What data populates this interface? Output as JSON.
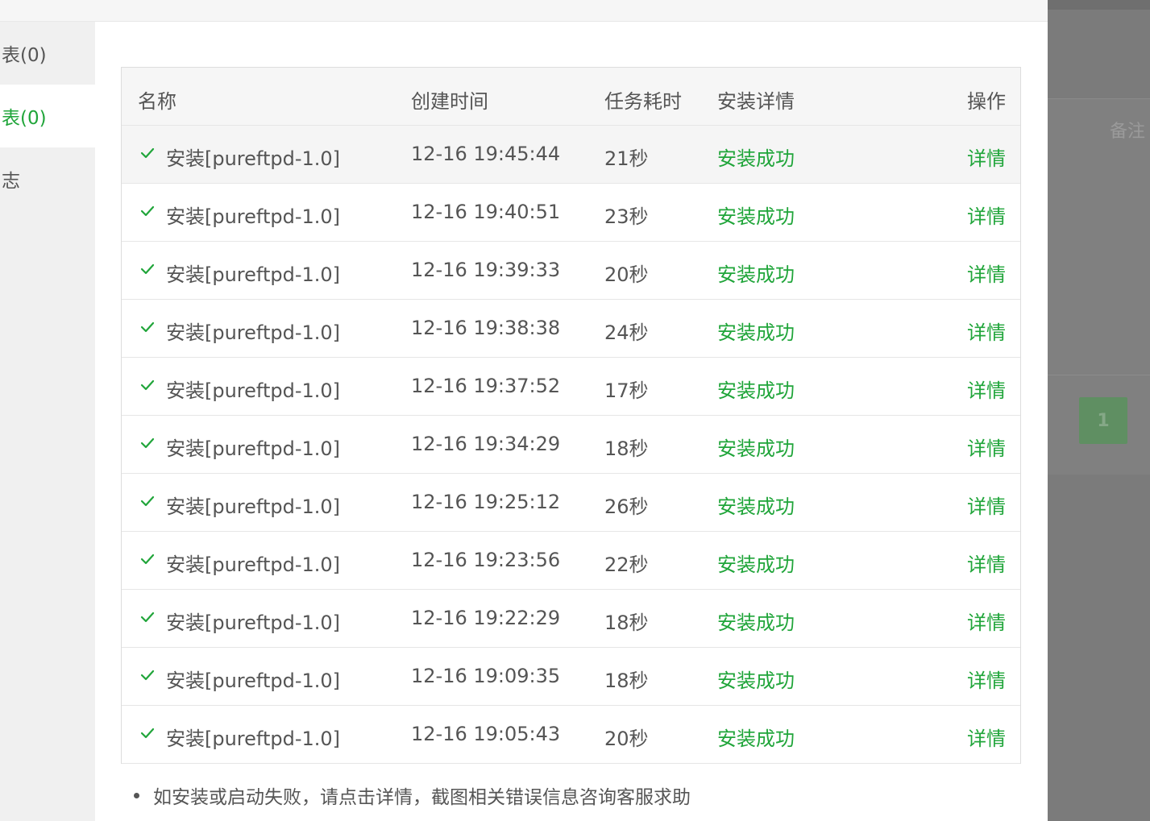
{
  "sidebar": {
    "items": [
      {
        "label": "表(0)"
      },
      {
        "label": "表(0)"
      },
      {
        "label": "志"
      }
    ]
  },
  "table": {
    "headers": {
      "name": "名称",
      "created": "创建时间",
      "duration": "任务耗时",
      "detail": "安装详情",
      "action": "操作"
    },
    "rows": [
      {
        "name": "安装[pureftpd-1.0]",
        "created": "12-16 19:45:44",
        "duration": "21秒",
        "status": "安装成功",
        "action": "详情"
      },
      {
        "name": "安装[pureftpd-1.0]",
        "created": "12-16 19:40:51",
        "duration": "23秒",
        "status": "安装成功",
        "action": "详情"
      },
      {
        "name": "安装[pureftpd-1.0]",
        "created": "12-16 19:39:33",
        "duration": "20秒",
        "status": "安装成功",
        "action": "详情"
      },
      {
        "name": "安装[pureftpd-1.0]",
        "created": "12-16 19:38:38",
        "duration": "24秒",
        "status": "安装成功",
        "action": "详情"
      },
      {
        "name": "安装[pureftpd-1.0]",
        "created": "12-16 19:37:52",
        "duration": "17秒",
        "status": "安装成功",
        "action": "详情"
      },
      {
        "name": "安装[pureftpd-1.0]",
        "created": "12-16 19:34:29",
        "duration": "18秒",
        "status": "安装成功",
        "action": "详情"
      },
      {
        "name": "安装[pureftpd-1.0]",
        "created": "12-16 19:25:12",
        "duration": "26秒",
        "status": "安装成功",
        "action": "详情"
      },
      {
        "name": "安装[pureftpd-1.0]",
        "created": "12-16 19:23:56",
        "duration": "22秒",
        "status": "安装成功",
        "action": "详情"
      },
      {
        "name": "安装[pureftpd-1.0]",
        "created": "12-16 19:22:29",
        "duration": "18秒",
        "status": "安装成功",
        "action": "详情"
      },
      {
        "name": "安装[pureftpd-1.0]",
        "created": "12-16 19:09:35",
        "duration": "18秒",
        "status": "安装成功",
        "action": "详情"
      },
      {
        "name": "安装[pureftpd-1.0]",
        "created": "12-16 19:05:43",
        "duration": "20秒",
        "status": "安装成功",
        "action": "详情"
      }
    ]
  },
  "note": "如安装或启动失败，请点击详情，截图相关错误信息咨询客服求助",
  "background": {
    "note_label": "备注",
    "page_button": "1"
  },
  "icons": {
    "row_status": "check-icon"
  },
  "colors": {
    "accent": "#20a53a",
    "text": "#555555"
  }
}
